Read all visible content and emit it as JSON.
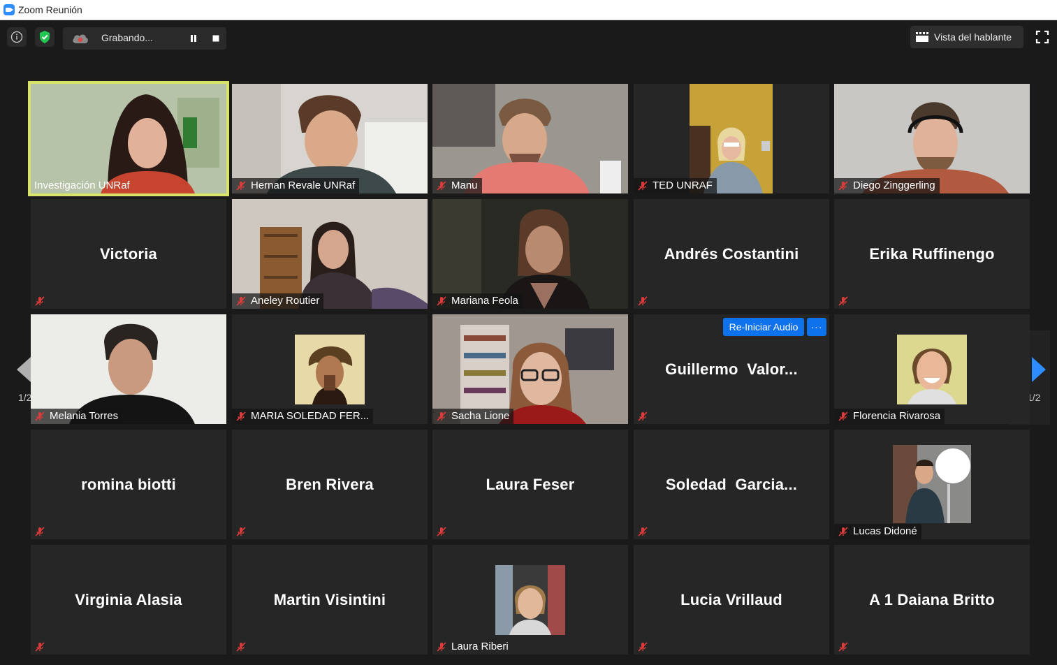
{
  "window": {
    "title": "Zoom Reunión"
  },
  "toolbar": {
    "recording_label": "Grabando...",
    "speaker_view_label": "Vista del hablante"
  },
  "pagination": {
    "left_label": "1/2",
    "right_label": "1/2"
  },
  "colors": {
    "accent_blue": "#0e72ed",
    "active_speaker_border": "#d8e36a",
    "mic_muted_red": "#e03b3b",
    "shield_green": "#23c552"
  },
  "participants": [
    {
      "name": "Investigación UNRaf",
      "video": true,
      "active_speaker": true,
      "muted": false
    },
    {
      "name": "Hernan Revale UNRaf",
      "video": true,
      "muted": true
    },
    {
      "name": "Manu",
      "video": true,
      "muted": true
    },
    {
      "name": "TED UNRAF",
      "video": true,
      "muted": true
    },
    {
      "name": "Diego Zinggerling",
      "video": true,
      "muted": true
    },
    {
      "name": "Victoria",
      "video": false,
      "muted": true
    },
    {
      "name": "Aneley Routier",
      "video": true,
      "muted": true
    },
    {
      "name": "Mariana Feola",
      "video": true,
      "muted": true
    },
    {
      "name": "Andrés Costantini",
      "video": false,
      "muted": true
    },
    {
      "name": "Erika Ruffinengo",
      "video": false,
      "muted": true
    },
    {
      "name": "Melania Torres",
      "video": true,
      "muted": true
    },
    {
      "name": "MARIA SOLEDAD FER...",
      "video": false,
      "profile_photo": true,
      "muted": true
    },
    {
      "name": "Sacha Lione",
      "video": true,
      "muted": true
    },
    {
      "name": "Guillermo  Valor...",
      "video": false,
      "muted": true,
      "reaudio_label": "Re-Iniciar Audio",
      "more_label": "···"
    },
    {
      "name": "Florencia Rivarosa",
      "video": false,
      "profile_photo": true,
      "muted": true
    },
    {
      "name": "romina biotti",
      "video": false,
      "muted": true
    },
    {
      "name": "Bren Rivera",
      "video": false,
      "muted": true
    },
    {
      "name": "Laura Feser",
      "video": false,
      "muted": true
    },
    {
      "name": "Soledad  Garcia...",
      "video": false,
      "muted": true
    },
    {
      "name": "Lucas Didoné",
      "video": false,
      "profile_photo": true,
      "muted": true
    },
    {
      "name": "Virginia Alasia",
      "video": false,
      "muted": true
    },
    {
      "name": "Martin Visintini",
      "video": false,
      "muted": true
    },
    {
      "name": "Laura Riberi",
      "video": false,
      "profile_photo": true,
      "muted": true
    },
    {
      "name": "Lucia Vrillaud",
      "video": false,
      "muted": true
    },
    {
      "name": "A 1 Daiana Britto",
      "video": false,
      "muted": true
    }
  ]
}
